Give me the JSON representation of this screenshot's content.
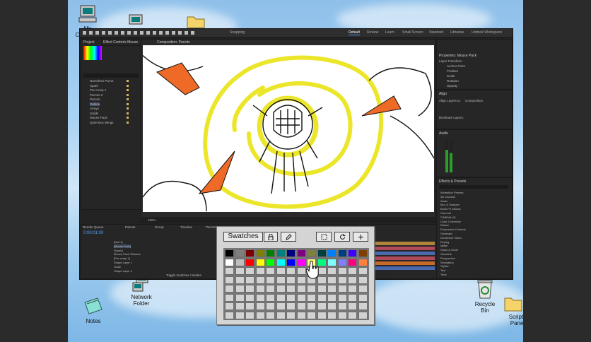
{
  "desktop": {
    "icons": {
      "my_computer": "My Computer",
      "network_folder": "Network Folder",
      "notes": "Notes",
      "recycle_bin": "Recycle Bin",
      "scripts_panel": "Scripts Panel"
    }
  },
  "ae": {
    "workspaces": [
      "Default",
      "Review",
      "Learn",
      "Small Screen",
      "Standard",
      "Libraries",
      "Undock Workspace"
    ],
    "snapping": "Snapping",
    "project_tab": "Project",
    "effect_controls_tab": "Effect Controls Mouse",
    "composition_tab": "Composition: Parrots",
    "project_items": [
      "Nameless Parrot",
      "Spark",
      "Pre-comp 1",
      "Parrots 2",
      "Parrots",
      "Outline",
      "Arrays",
      "Solids",
      "Mouse Pack",
      "Quiet Box Wings"
    ],
    "properties_title": "Properties: Mouse Pack",
    "layer_transform": "Layer Transform",
    "transform_rows": [
      "Anchor Point",
      "Position",
      "Scale",
      "Rotation",
      "Opacity"
    ],
    "align_title": "Align",
    "align_to": "Align Layers to:",
    "align_to_value": "Composition",
    "distribute": "Distribute Layers:",
    "audio_title": "Audio",
    "effects_title": "Effects & Presets",
    "effects_items": [
      "Animation Presets",
      "3D Channel",
      "Audio",
      "Blur & Sharpen",
      "Boris FX Mocha",
      "Channel",
      "CINEMA 4D",
      "Color Correction",
      "Distort",
      "Expression Controls",
      "Generate",
      "Immersive Video",
      "Keying",
      "Matte",
      "Noise & Grain",
      "Obsolete",
      "Perspective",
      "Simulation",
      "Stylize",
      "Text",
      "Time"
    ],
    "zoom": "100%",
    "timecode": "0:00:01:00",
    "timeline_tabs": [
      "Render Queue",
      "Parrots",
      "Group",
      "Timeline",
      "Parrots 2",
      "Pre-comp 1",
      "Spark"
    ],
    "layers": [
      "[Null 1]",
      "[Mouse Pack]",
      "[Spark]",
      "Mouse Pack Shadow",
      "[Pre-comp 1]",
      "Shape Layer 1",
      "Scale",
      "Shape Layer 2"
    ],
    "footer": "Toggle Switches / Modes"
  },
  "palette": {
    "swatches_label": "Swatches",
    "lock_icon": "lock-icon",
    "pencil_icon": "pencil-icon",
    "select_icon": "marquee-icon",
    "refresh_icon": "refresh-icon",
    "add_icon": "plus-icon",
    "row1_colors": [
      "#000000",
      "#7f7f7f",
      "#7f0000",
      "#7f7f00",
      "#007f00",
      "#007f7f",
      "#00007f",
      "#7f007f",
      "#7f7f3f",
      "#003f3f",
      "#007fff",
      "#003f7f",
      "#3f00ff",
      "#7f3f00"
    ],
    "row2_colors": [
      "#ffffff",
      "#bfbfbf",
      "#ff0000",
      "#ffff00",
      "#00ff00",
      "#00ffff",
      "#0000ff",
      "#ff00ff",
      "#ffff7f",
      "#00ff7f",
      "#7fffff",
      "#7f7fff",
      "#ff007f",
      "#ff7f3f"
    ],
    "empty_rows": 6
  }
}
